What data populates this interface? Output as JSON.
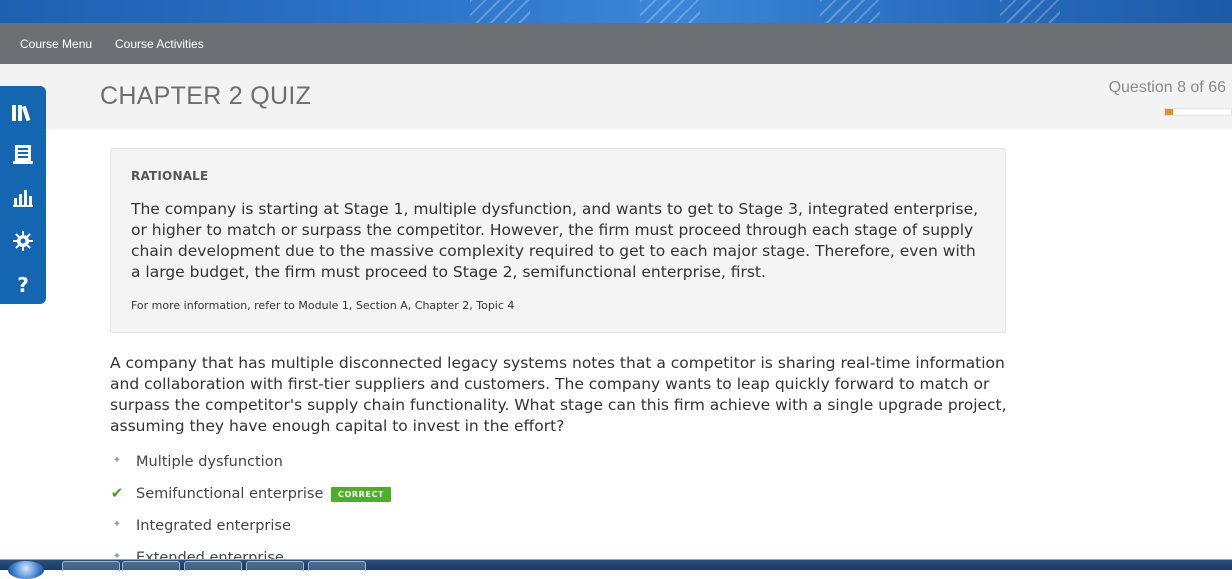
{
  "nav": {
    "course_menu": "Course Menu",
    "course_activities": "Course Activities"
  },
  "header": {
    "title": "CHAPTER 2 QUIZ",
    "question_counter": "Question 8 of 66",
    "progress_fraction": 0.121
  },
  "sidebar": {
    "icons": [
      "library-icon",
      "notebook-icon",
      "bar-chart-icon",
      "gear-icon",
      "help-icon"
    ]
  },
  "rationale": {
    "heading": "RATIONALE",
    "body": "The company is starting at Stage 1, multiple dysfunction, and wants to get to Stage 3, integrated enterprise, or higher to match or surpass the competitor. However, the firm must proceed through each stage of supply chain development due to the massive complexity required to get to each major stage. Therefore, even with a large budget, the firm must proceed to Stage 2, semifunctional enterprise, first.",
    "more_info": "For more information, refer to Module 1, Section A, Chapter 2, Topic 4"
  },
  "question": {
    "text": "A company that has multiple disconnected legacy systems notes that a competitor is sharing real-time information and collaboration with first-tier suppliers and customers. The company wants to leap quickly forward to match or surpass the competitor's supply chain functionality. What stage can this firm achieve with a single upgrade project, assuming they have enough capital to invest in the effort?",
    "answers": [
      {
        "label": "Multiple dysfunction"
      },
      {
        "label": "Semifunctional enterprise",
        "badge": "CORRECT"
      },
      {
        "label": "Integrated enterprise"
      },
      {
        "label": "Extended enterprise"
      }
    ]
  },
  "colors": {
    "sidebar": "#1466b0",
    "progress": "#f08a24",
    "correct_badge": "#4caf2a",
    "navbar": "#6c7075"
  }
}
